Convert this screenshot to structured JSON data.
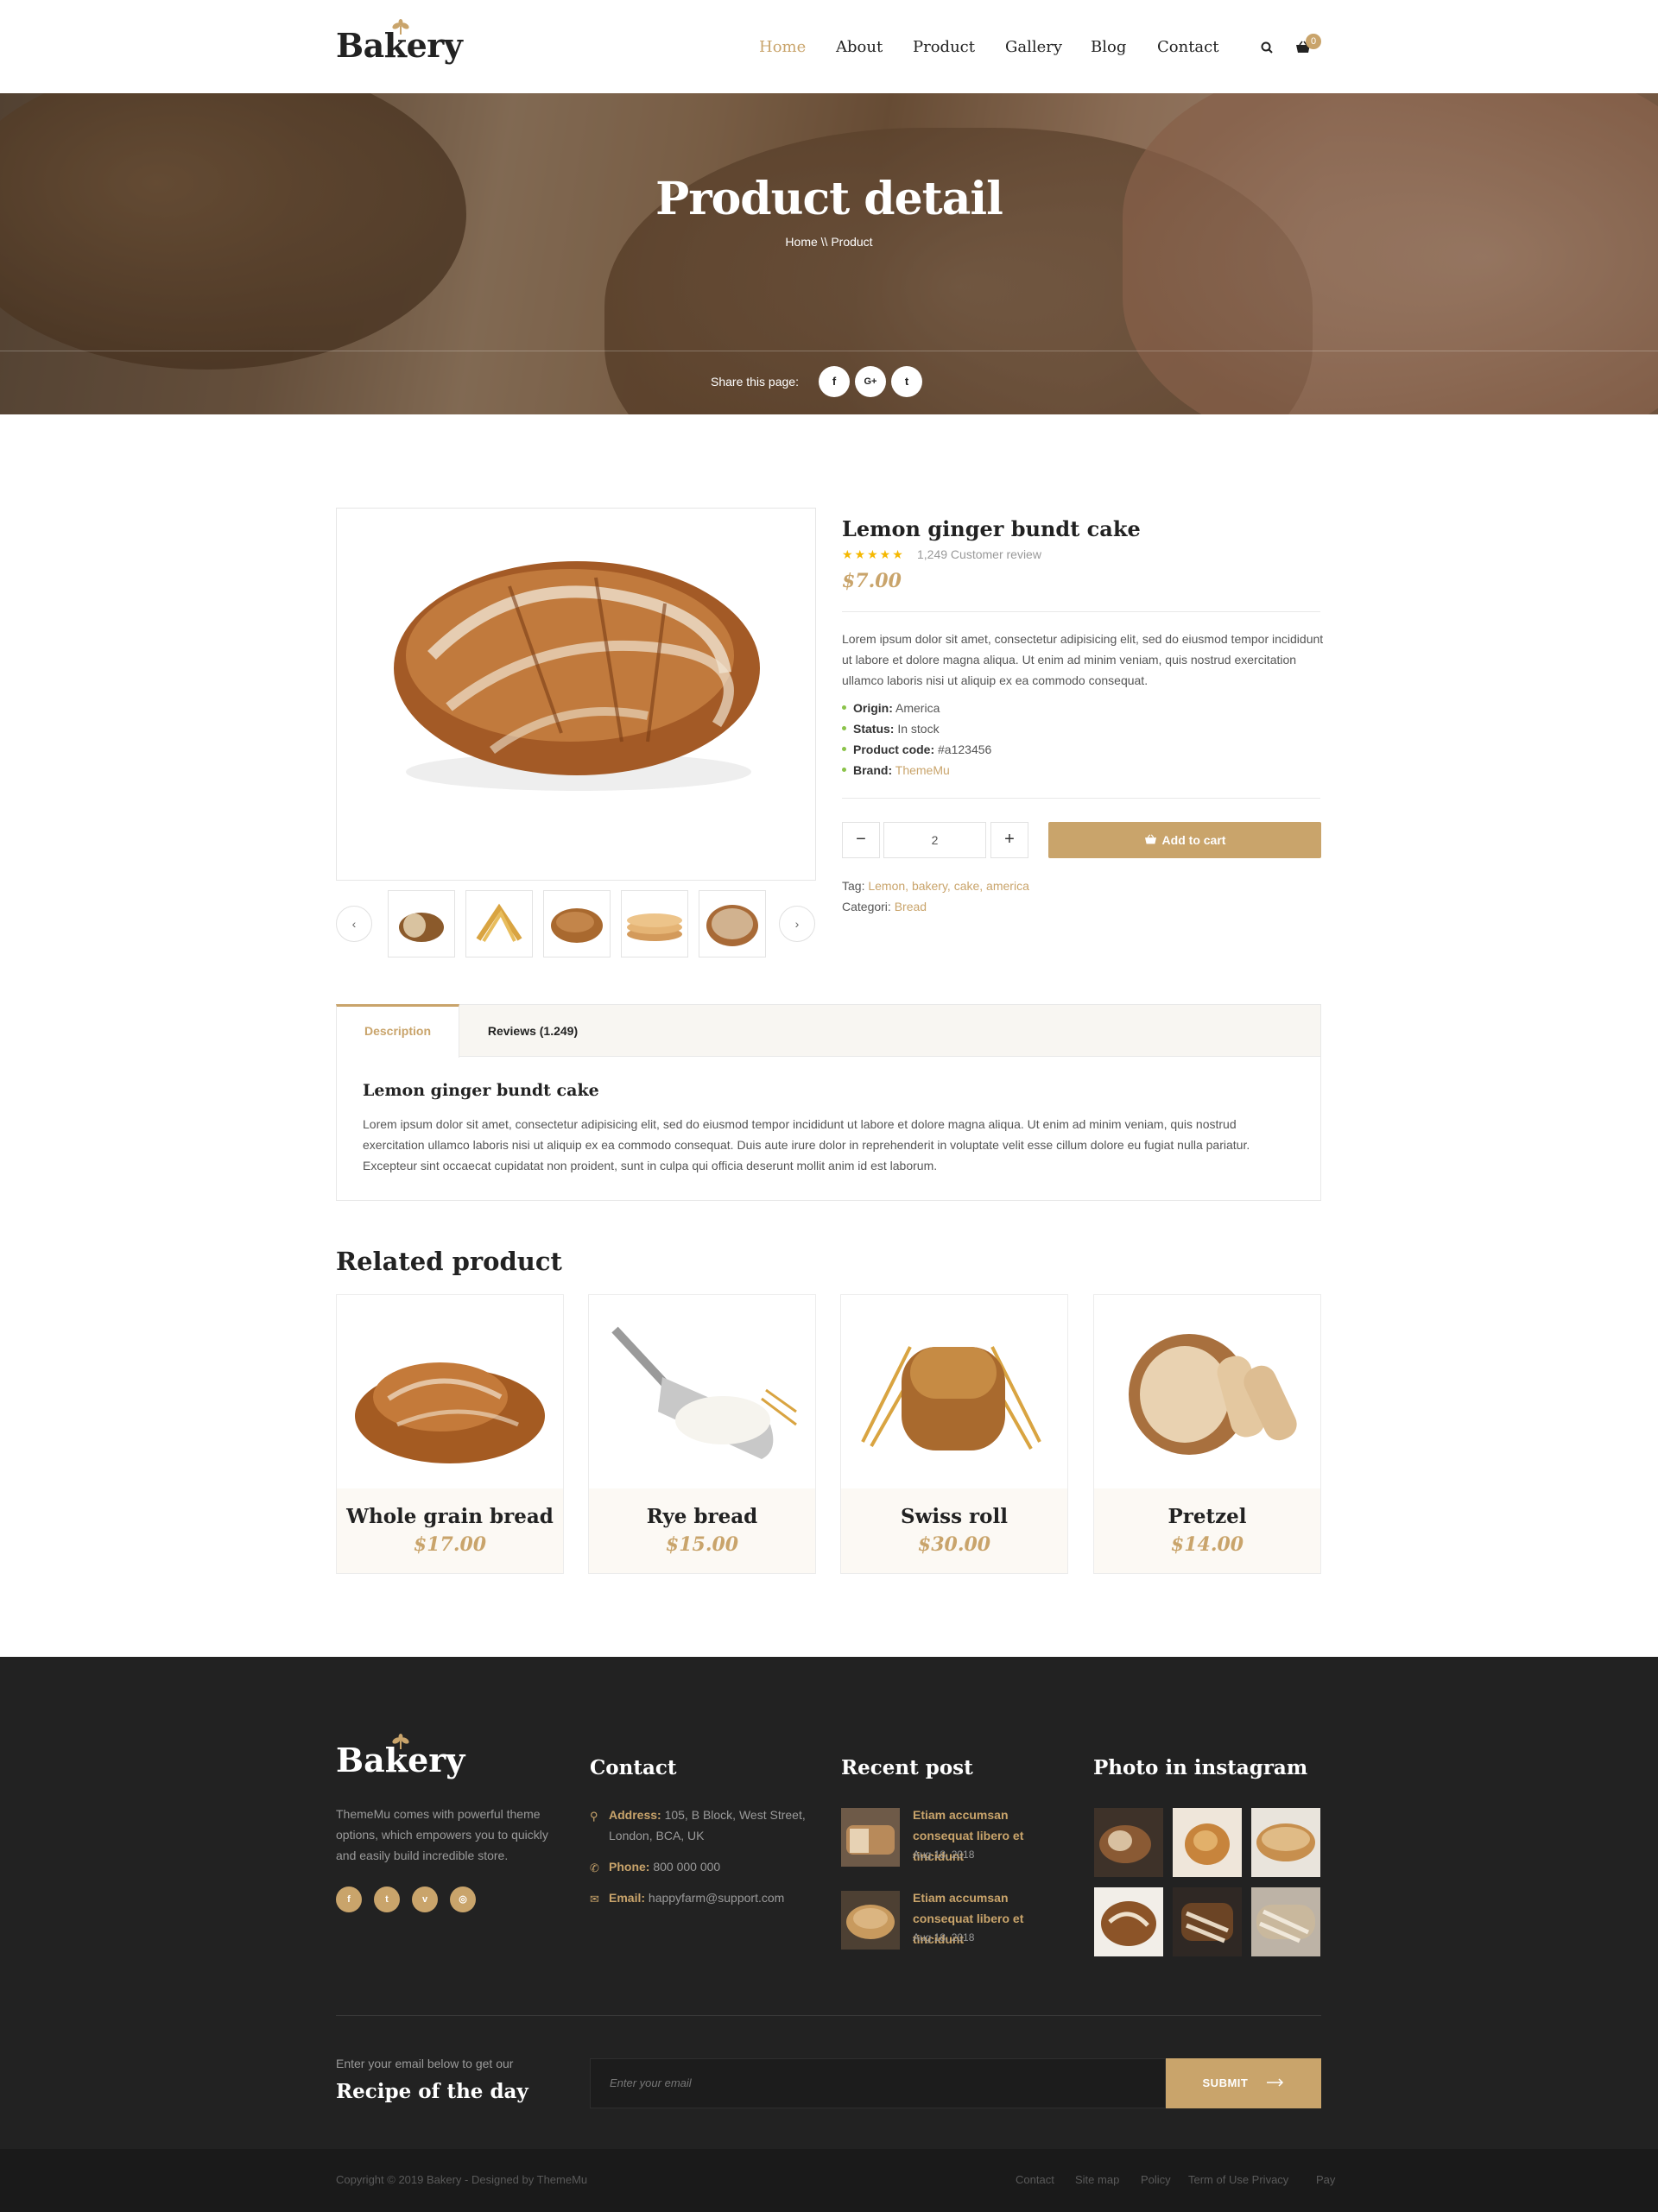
{
  "header": {
    "logo": "Bakery",
    "nav": [
      {
        "label": "Home",
        "active": true
      },
      {
        "label": "About"
      },
      {
        "label": "Product"
      },
      {
        "label": "Gallery"
      },
      {
        "label": "Blog"
      },
      {
        "label": "Contact"
      }
    ],
    "cart_count": "0"
  },
  "hero": {
    "title": "Product detail",
    "breadcrumb": "Home  \\\\  Product",
    "share_label": "Share this page:",
    "share_icons": [
      "f",
      "G+",
      "t"
    ]
  },
  "product": {
    "name": "Lemon ginger bundt cake",
    "stars": "★★★★★",
    "reviews": "1,249 Customer review",
    "price": "$7.00",
    "description": "Lorem ipsum dolor sit amet, consectetur adipisicing elit, sed do eiusmod tempor incididunt ut labore et dolore magna aliqua. Ut enim ad minim veniam, quis nostrud exercitation ullamco laboris nisi ut aliquip ex ea commodo consequat.",
    "specs": [
      {
        "label": "Origin:",
        "value": "America"
      },
      {
        "label": "Status:",
        "value": "In stock"
      },
      {
        "label": "Product code:",
        "value": "#a123456"
      },
      {
        "label": "Brand:",
        "value": "ThemeMu"
      }
    ],
    "quantity": "2",
    "minus": "−",
    "plus": "+",
    "add_to_cart": "Add to cart",
    "tag_label": "Tag:",
    "tags": "Lemon, bakery, cake, america",
    "category_label": "Categori:",
    "category": "Bread",
    "prev": "‹",
    "next": "›"
  },
  "tabs": {
    "items": [
      "Description",
      "Reviews (1.249)"
    ],
    "content_title": "Lemon ginger bundt cake",
    "content_text": "Lorem ipsum dolor sit amet, consectetur adipisicing elit, sed do eiusmod tempor incididunt ut labore et dolore magna aliqua. Ut enim ad minim veniam, quis nostrud exercitation ullamco laboris nisi ut aliquip ex ea commodo consequat. Duis aute irure dolor in reprehenderit in voluptate velit esse cillum dolore eu fugiat nulla pariatur. Excepteur sint occaecat cupidatat non proident, sunt in culpa qui officia deserunt mollit anim id est laborum."
  },
  "related": {
    "heading": "Related product",
    "items": [
      {
        "name": "Whole grain bread",
        "price": "$17.00"
      },
      {
        "name": "Rye bread",
        "price": "$15.00"
      },
      {
        "name": "Swiss roll",
        "price": "$30.00"
      },
      {
        "name": "Pretzel",
        "price": "$14.00"
      }
    ]
  },
  "footer": {
    "logo": "Bakery",
    "about": "ThemeMu comes with powerful theme options, which empowers you to quickly and easily build incredible store.",
    "social": [
      "f",
      "t",
      "v",
      "◎"
    ],
    "contact_heading": "Contact",
    "address_label": "Address:",
    "address": "105, B Block, West Street, London, BCA, UK",
    "phone_label": "Phone:",
    "phone": "800 000 000",
    "email_label": "Email:",
    "email": "happyfarm@support.com",
    "recent_heading": "Recent post",
    "posts": [
      {
        "title": "Etiam accumsan consequat libero et tincidunt",
        "date": "Aug 18, 2018"
      },
      {
        "title": "Etiam accumsan consequat libero et tincidunt",
        "date": "Aug 18, 2018"
      }
    ],
    "instagram_heading": "Photo in instagram",
    "newsletter_small": "Enter your email below to get our",
    "newsletter_big": "Recipe of the day",
    "email_placeholder": "Enter your email",
    "submit": "SUBMIT",
    "copyright": "Copyright © 2019 Bakery - Designed by ThemeMu",
    "links": [
      "Contact",
      "Site map",
      "Policy",
      "Term of Use Privacy",
      "Pay"
    ]
  },
  "colors": {
    "accent": "#c9a46b",
    "dark": "#222222",
    "footer_bottom": "#1a1a1a"
  }
}
